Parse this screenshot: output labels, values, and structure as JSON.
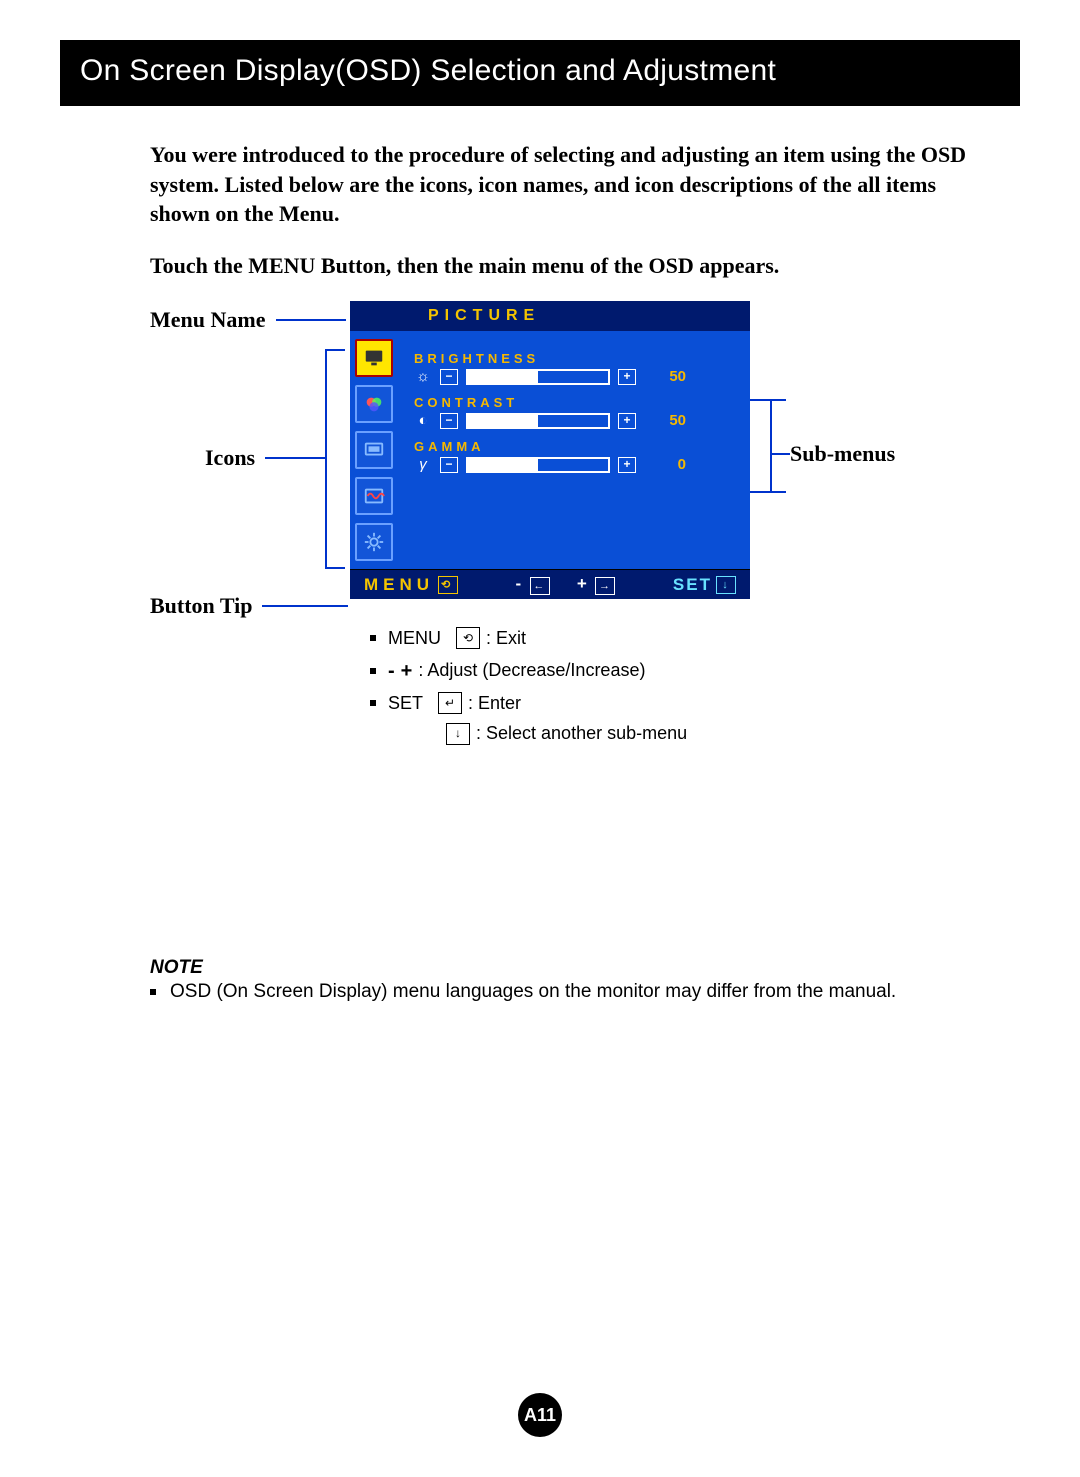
{
  "title": "On Screen Display(OSD) Selection and Adjustment",
  "intro": "You were introduced to the procedure of selecting and adjusting an item using the OSD system.  Listed below are the icons, icon names, and icon descriptions of the all items shown on the Menu.",
  "instruction": "Touch the MENU Button, then the main menu of the OSD appears.",
  "labels": {
    "menu_name": "Menu Name",
    "icons": "Icons",
    "button_tip": "Button Tip",
    "sub_menus": "Sub-menus"
  },
  "osd": {
    "header": "PICTURE",
    "sidebar_icons": [
      "picture-icon",
      "rgb-icon",
      "screen-icon",
      "wave-icon",
      "gear-icon"
    ],
    "submenus": [
      {
        "title": "BRIGHTNESS",
        "symbol": "☼",
        "value": "50",
        "fill_pct": 50
      },
      {
        "title": "CONTRAST",
        "symbol": "◐",
        "value": "50",
        "fill_pct": 50
      },
      {
        "title": "GAMMA",
        "symbol": "γ",
        "value": "0",
        "fill_pct": 50
      }
    ],
    "footer": {
      "menu": "MENU",
      "minus": "-",
      "plus": "+",
      "set": "SET"
    }
  },
  "legend": {
    "items": [
      {
        "prefix": "MENU",
        "glyph": "⟲",
        "text": ": Exit"
      },
      {
        "prefix_pm": true,
        "text": ": Adjust (Decrease/Increase)"
      },
      {
        "prefix": "SET",
        "glyph": "↵",
        "text": ": Enter"
      },
      {
        "glyph_only": "↓",
        "text": ": Select another sub-menu"
      }
    ]
  },
  "note": {
    "heading": "NOTE",
    "text": "OSD (On Screen Display) menu languages on the monitor may differ from the manual."
  },
  "page_number": "A11"
}
